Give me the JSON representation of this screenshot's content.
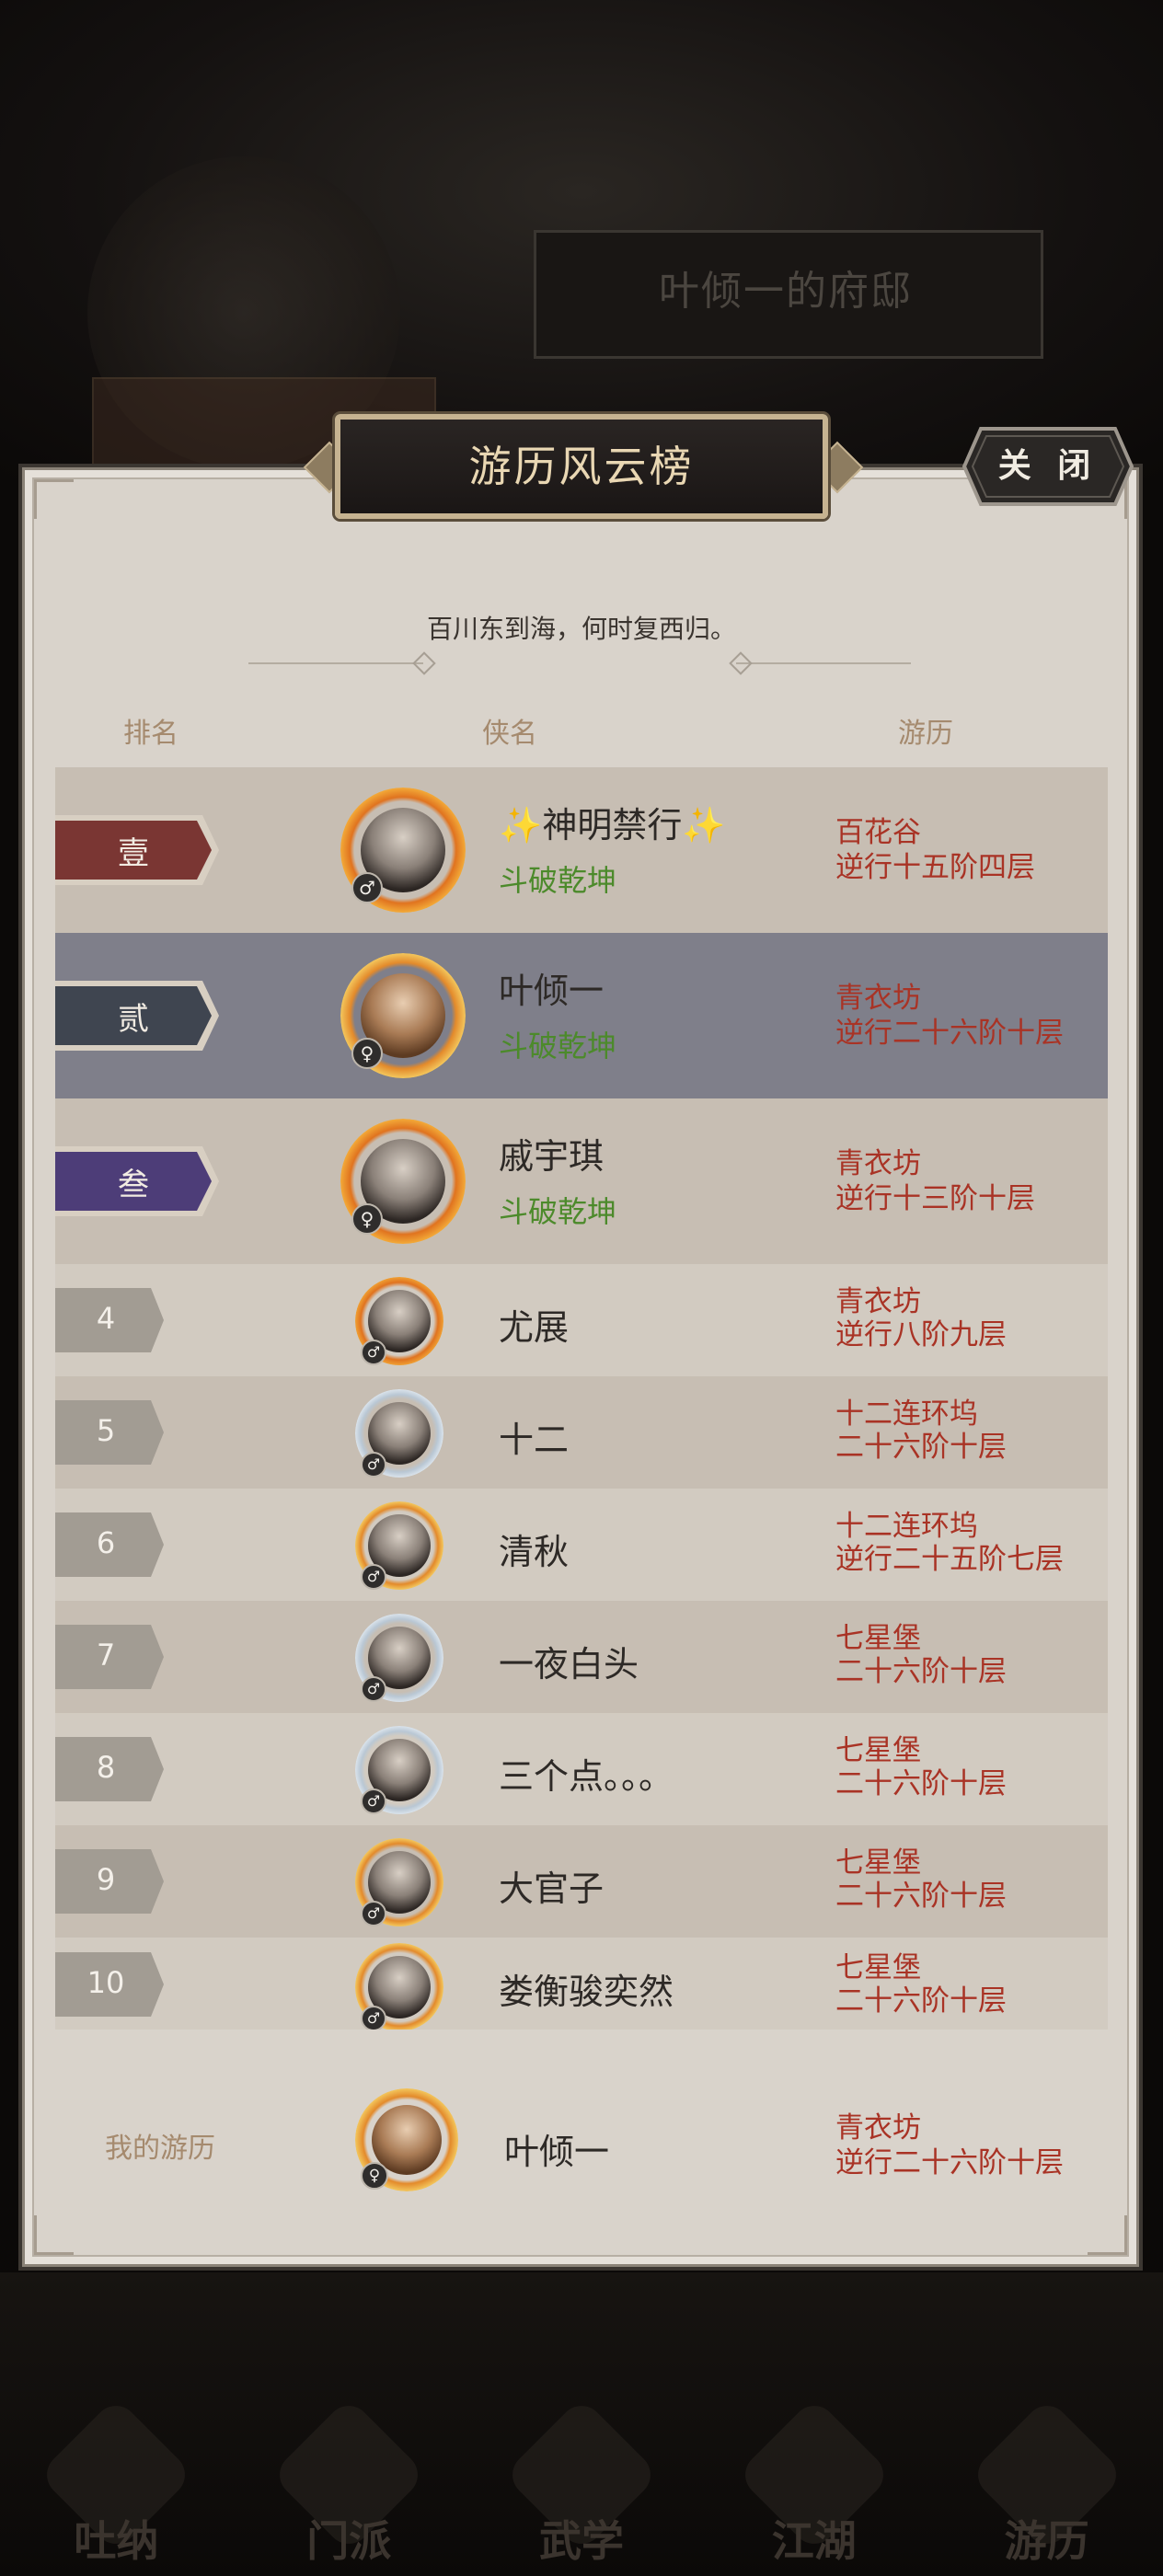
{
  "background": {
    "residence_name": "叶倾一的府邸",
    "nav_items": [
      "吐纳",
      "门派",
      "武学",
      "江湖",
      "游历"
    ]
  },
  "panel": {
    "title": "游历风云榜",
    "close_label": "关 闭",
    "subtitle": "百川东到海，何时复西归。",
    "columns": {
      "rank": "排名",
      "name": "侠名",
      "travel": "游历"
    }
  },
  "rows": [
    {
      "rank": "壹",
      "name": "✨神明禁行✨",
      "title": "斗破乾坤",
      "gender": "♂",
      "place": "百花谷",
      "progress": "逆行十五阶四层"
    },
    {
      "rank": "贰",
      "name": "叶倾一",
      "title": "斗破乾坤",
      "gender": "♀",
      "place": "青衣坊",
      "progress": "逆行二十六阶十层"
    },
    {
      "rank": "叁",
      "name": "戚宇琪",
      "title": "斗破乾坤",
      "gender": "♀",
      "place": "青衣坊",
      "progress": "逆行十三阶十层"
    },
    {
      "rank": "4",
      "name": "尤展",
      "gender": "♂",
      "place": "青衣坊",
      "progress": "逆行八阶九层"
    },
    {
      "rank": "5",
      "name": "十二",
      "gender": "♂",
      "place": "十二连环坞",
      "progress": "二十六阶十层"
    },
    {
      "rank": "6",
      "name": "清秋",
      "gender": "♂",
      "place": "十二连环坞",
      "progress": "逆行二十五阶七层"
    },
    {
      "rank": "7",
      "name": "一夜白头",
      "gender": "♂",
      "place": "七星堡",
      "progress": "二十六阶十层"
    },
    {
      "rank": "8",
      "name": "三个点。。。",
      "gender": "♂",
      "place": "七星堡",
      "progress": "二十六阶十层"
    },
    {
      "rank": "9",
      "name": "大官子",
      "gender": "♂",
      "place": "七星堡",
      "progress": "二十六阶十层"
    },
    {
      "rank": "10",
      "name": "娄衡骏奕然",
      "gender": "♂",
      "place": "七星堡",
      "progress": "二十六阶十层"
    }
  ],
  "me": {
    "label": "我的游历",
    "name": "叶倾一",
    "gender": "♀",
    "place": "青衣坊",
    "progress": "逆行二十六阶十层"
  },
  "colors": {
    "rank1": "#7a3633",
    "rank2": "#3f4550",
    "rank3": "#4d3d78",
    "rank_num": "#a29c93",
    "title_green": "#4c8a2b",
    "location_red": "#a93325"
  }
}
